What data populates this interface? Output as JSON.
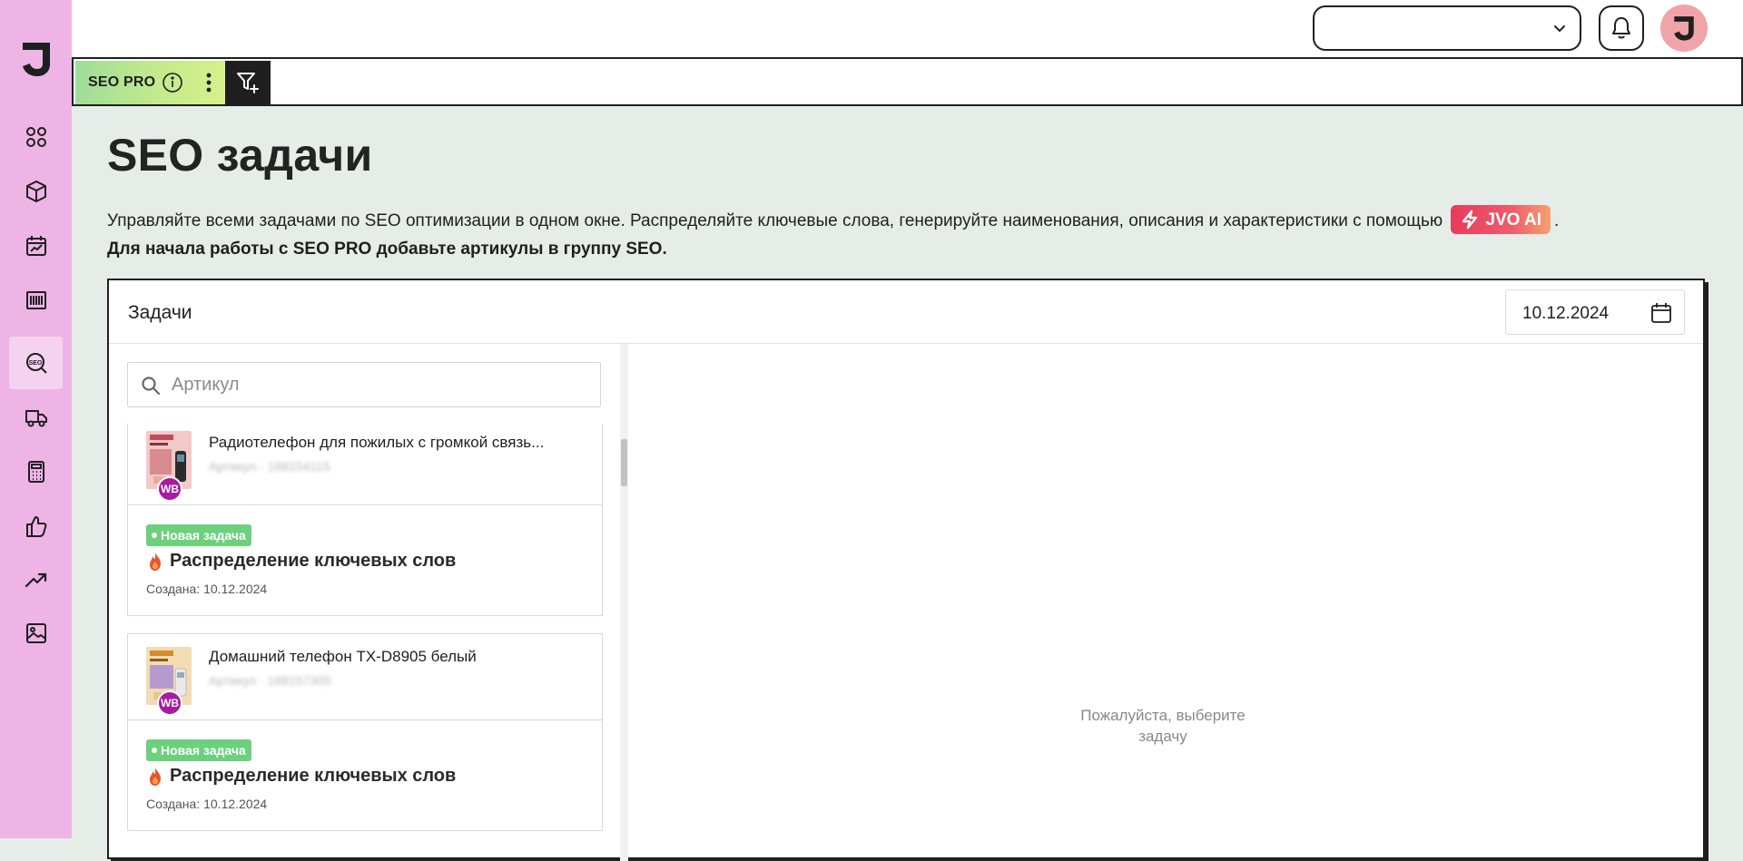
{
  "sidebar": {
    "items": [
      {
        "name": "dashboard",
        "icon": "grid-icon"
      },
      {
        "name": "products",
        "icon": "box-icon"
      },
      {
        "name": "calendar-analytics",
        "icon": "calendar-chart-icon"
      },
      {
        "name": "barcode",
        "icon": "barcode-icon"
      },
      {
        "name": "seo",
        "icon": "seo-search-icon",
        "active": true
      },
      {
        "name": "delivery",
        "icon": "truck-icon"
      },
      {
        "name": "calculator",
        "icon": "calculator-icon"
      },
      {
        "name": "feedback",
        "icon": "thumb-up-icon"
      },
      {
        "name": "trends",
        "icon": "trending-up-icon"
      },
      {
        "name": "media",
        "icon": "image-icon"
      }
    ]
  },
  "topbar": {
    "select_value": ""
  },
  "tabs": {
    "seo_label": "SEO PRO"
  },
  "page": {
    "title": "SEO задачи",
    "desc_part1": "Управляйте всеми задачами по SEO оптимизации в одном окне. Распределяйте ключевые слова, генерируйте наименования, описания и характеристики с помощью",
    "ai_badge": "JVO AI",
    "desc_part1_end": ".",
    "desc_part2": "Для начала работы с SEO PRO добавьте артикулы в группу SEO."
  },
  "tasks_panel": {
    "title": "Задачи",
    "date": "10.12.2024",
    "search_placeholder": "Артикул",
    "empty_text": "Пожалуйста, выберите задачу"
  },
  "cards": [
    {
      "product_name": "Радиотелефон для пожилых с громкой связь...",
      "meta": "Артикул · 188154115",
      "marketplace": "WB",
      "badge": "Новая задача",
      "task_title": "Распределение ключевых слов",
      "created": "Создана: 10.12.2024"
    },
    {
      "product_name": "Домашний телефон TX-D8905 белый",
      "meta": "Артикул · 188157305",
      "marketplace": "WB",
      "badge": "Новая задача",
      "task_title": "Распределение ключевых слов",
      "created": "Создана: 10.12.2024"
    }
  ],
  "colors": {
    "sidebar": "#eeb4e6",
    "background": "#e6ede9",
    "badge_green": "#6cd07c",
    "wb_purple": "#a81ba0",
    "avatar": "#f0a3a9"
  }
}
